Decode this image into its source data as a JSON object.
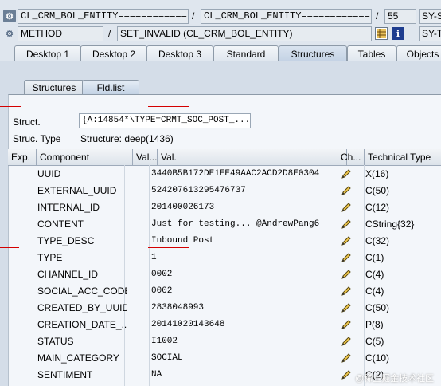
{
  "toolbar1": {
    "field1": "CL_CRM_BOL_ENTITY============",
    "field2": "CL_CRM_BOL_ENTITY============",
    "sep1": "/",
    "sep2": "/",
    "field3": "55",
    "field4": "SY-S"
  },
  "toolbar2": {
    "field1": "METHOD",
    "sep": "/",
    "field2": "SET_INVALID (CL_CRM_BOL_ENTITY)",
    "field3": "SY-T",
    "info_icon_label": "i"
  },
  "tabs": [
    {
      "label": "Desktop 1"
    },
    {
      "label": "Desktop 2"
    },
    {
      "label": "Desktop 3"
    },
    {
      "label": "Standard"
    },
    {
      "label": "Structures"
    },
    {
      "label": "Tables"
    },
    {
      "label": "Objects"
    }
  ],
  "subtabs": [
    {
      "label": "Structures"
    },
    {
      "label": "Fld.list"
    }
  ],
  "struct": {
    "label": "Struct.",
    "value": "{A:14854*\\TYPE=CRMT_SOC_POST_...",
    "type_label": "Struc. Type",
    "type_value": "Structure: deep(1436)"
  },
  "table": {
    "headers": [
      "Exp.",
      "Component",
      "Val...",
      "Val.",
      "Ch...",
      "Technical Type"
    ],
    "rows": [
      {
        "component": "UUID",
        "value": "3440B5B172DE1EE49AAC2ACD2D8E0304",
        "type": "X(16)"
      },
      {
        "component": "EXTERNAL_UUID",
        "value": "524207613295476737",
        "type": "C(50)"
      },
      {
        "component": "INTERNAL_ID",
        "value": "201400026173",
        "type": "C(12)"
      },
      {
        "component": "CONTENT",
        "value": "Just for testing... @AndrewPang6",
        "type": "CString{32}"
      },
      {
        "component": "TYPE_DESC",
        "value": "Inbound Post",
        "type": "C(32)"
      },
      {
        "component": "TYPE",
        "value": "1",
        "type": "C(1)"
      },
      {
        "component": "CHANNEL_ID",
        "value": "0002",
        "type": "C(4)"
      },
      {
        "component": "SOCIAL_ACC_CODE",
        "value": "0002",
        "type": "C(4)"
      },
      {
        "component": "CREATED_BY_UUID",
        "value": "2838048993",
        "type": "C(50)"
      },
      {
        "component": "CREATION_DATE_...",
        "value": "20141020143648",
        "type": "P(8)"
      },
      {
        "component": "STATUS",
        "value": "I1002",
        "type": "C(5)"
      },
      {
        "component": "MAIN_CATEGORY",
        "value": "SOCIAL",
        "type": "C(10)"
      },
      {
        "component": "SENTIMENT",
        "value": "NA",
        "type": "C(2)"
      }
    ]
  },
  "watermark": "@稀土掘金技术社区",
  "colors": {
    "annotation_red": "#d40000",
    "tab_border": "#8d9aa8",
    "panel_bg": "#d4dde8"
  }
}
